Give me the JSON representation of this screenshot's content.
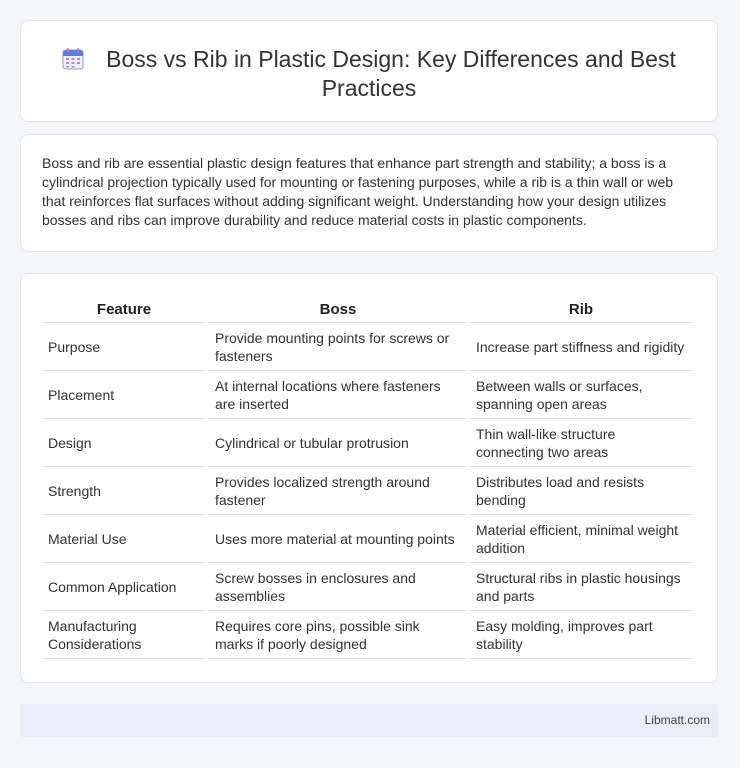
{
  "header": {
    "title": "Boss vs Rib in Plastic Design: Key Differences and Best Practices",
    "icon": "calendar-icon"
  },
  "intro": {
    "text": "Boss and rib are essential plastic design features that enhance part strength and stability; a boss is a cylindrical projection typically used for mounting or fastening purposes, while a rib is a thin wall or web that reinforces flat surfaces without adding significant weight. Understanding how your design utilizes bosses and ribs can improve durability and reduce material costs in plastic components."
  },
  "table": {
    "headers": [
      "Feature",
      "Boss",
      "Rib"
    ],
    "rows": [
      [
        "Purpose",
        "Provide mounting points for screws or fasteners",
        "Increase part stiffness and rigidity"
      ],
      [
        "Placement",
        "At internal locations where fasteners are inserted",
        "Between walls or surfaces, spanning open areas"
      ],
      [
        "Design",
        "Cylindrical or tubular protrusion",
        "Thin wall-like structure connecting two areas"
      ],
      [
        "Strength",
        "Provides localized strength around fastener",
        "Distributes load and resists bending"
      ],
      [
        "Material Use",
        "Uses more material at mounting points",
        "Material efficient, minimal weight addition"
      ],
      [
        "Common Application",
        "Screw bosses in enclosures and assemblies",
        "Structural ribs in plastic housings and parts"
      ],
      [
        "Manufacturing Considerations",
        "Requires core pins, possible sink marks if poorly designed",
        "Easy molding, improves part stability"
      ]
    ]
  },
  "footer": {
    "text": "Libmatt.com"
  }
}
